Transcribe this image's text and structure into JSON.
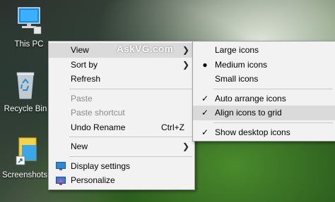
{
  "desktop": {
    "icons": [
      {
        "label": "This PC",
        "icon": "this-pc-icon"
      },
      {
        "label": "Recycle Bin",
        "icon": "recycle-bin-icon"
      },
      {
        "label": "Screenshots",
        "icon": "folder-icon"
      }
    ]
  },
  "watermark": "AskVG.com",
  "context_menu": {
    "view": "View",
    "sort_by": "Sort by",
    "refresh": "Refresh",
    "paste": "Paste",
    "paste_shortcut": "Paste shortcut",
    "undo_rename": "Undo Rename",
    "undo_shortcut": "Ctrl+Z",
    "new": "New",
    "display_settings": "Display settings",
    "personalize": "Personalize"
  },
  "view_submenu": {
    "large_icons": "Large icons",
    "medium_icons": "Medium icons",
    "small_icons": "Small icons",
    "auto_arrange": "Auto arrange icons",
    "align_grid": "Align icons to grid",
    "show_desktop": "Show desktop icons",
    "selected_size": "Medium icons",
    "checked": [
      "Auto arrange icons",
      "Align icons to grid",
      "Show desktop icons"
    ]
  },
  "colors": {
    "menu_bg": "#f2f2f2",
    "hover_bg": "#dadada",
    "disabled_text": "#8a8a8a"
  }
}
